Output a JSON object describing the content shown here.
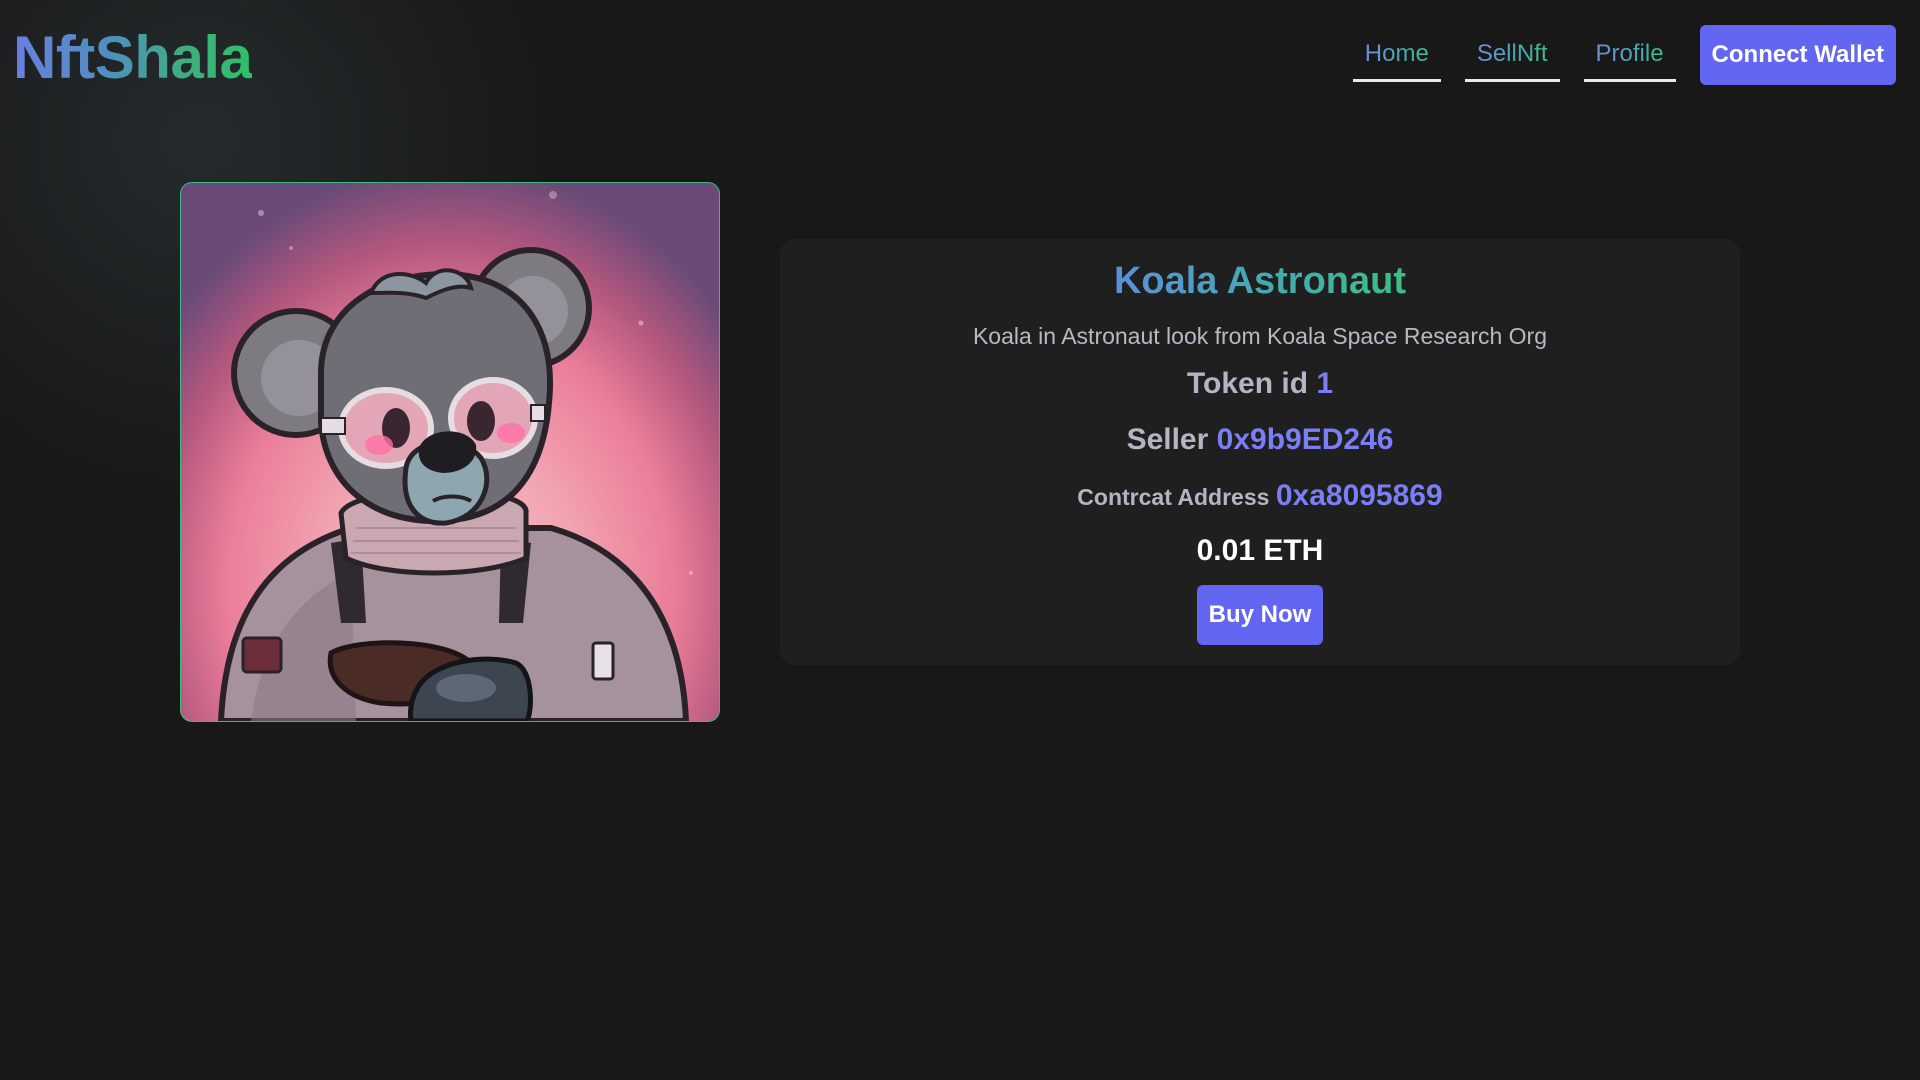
{
  "header": {
    "logo": "NftShala",
    "nav": [
      {
        "label": "Home"
      },
      {
        "label": "SellNft"
      },
      {
        "label": "Profile"
      }
    ],
    "connect_label": "Connect Wallet"
  },
  "nft": {
    "title": "Koala Astronaut",
    "description": "Koala in Astronaut look from Koala Space Research Org",
    "token_label": "Token id",
    "token_value": "1",
    "seller_label": "Seller",
    "seller_value": "0x9b9ED246",
    "contract_label": "Contrcat Address",
    "contract_value": "0xa8095869",
    "price": "0.01 ETH",
    "buy_label": "Buy Now"
  },
  "colors": {
    "accent": "#6366f1",
    "background": "#181818",
    "card": "#1f1f1f",
    "value": "#7b7ff5"
  }
}
